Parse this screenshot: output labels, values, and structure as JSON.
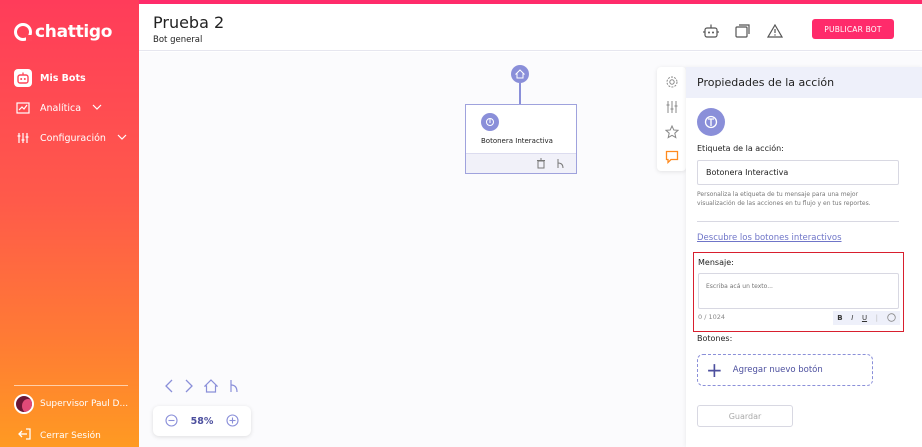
{
  "app": {
    "logo_text": "chattigo"
  },
  "sidebar": {
    "items": [
      {
        "label": "Mis Bots",
        "icon": "robot-icon",
        "active": true
      },
      {
        "label": "Analítica",
        "icon": "analytics-icon",
        "expandable": true
      },
      {
        "label": "Configuración",
        "icon": "sliders-icon",
        "expandable": true
      }
    ],
    "user_name": "Supervisor Paul D...",
    "logout_label": "Cerrar Sesión"
  },
  "header": {
    "title": "Prueba 2",
    "subtitle": "Bot general",
    "publish_label": "PUBLICAR BOT"
  },
  "canvas": {
    "node_label": "Botonera Interactiva",
    "zoom": "58%"
  },
  "panel": {
    "title": "Propiedades de la acción",
    "label_title": "Etiqueta de la acción:",
    "label_value": "Botonera Interactiva",
    "help_text": "Personaliza la etiqueta de tu mensaje para una mejor visualización de las acciones en tu flujo y en tus reportes.",
    "link_text": "Descubre los botones interactivos",
    "message_label": "Mensaje:",
    "message_placeholder": "Escriba acá un texto...",
    "counter": "0 / 1024",
    "format": {
      "bold": "B",
      "italic": "I",
      "underline": "U"
    },
    "buttons_label": "Botones:",
    "add_button_label": "Agregar nuevo botón",
    "save_label": "Guardar"
  },
  "colors": {
    "accent": "#ff2b6b",
    "node": "#8a8fd9",
    "highlight": "#d81f2e"
  }
}
